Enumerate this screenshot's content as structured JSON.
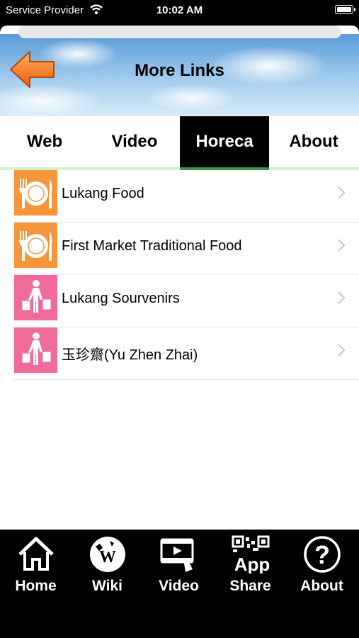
{
  "status_bar": {
    "carrier": "Service Provider",
    "time": "10:02 AM"
  },
  "header": {
    "title": "More Links"
  },
  "tabs": [
    {
      "label": "Web"
    },
    {
      "label": "Video"
    },
    {
      "label": "Horeca",
      "selected": true
    },
    {
      "label": "About"
    }
  ],
  "list": [
    {
      "label": "Lukang Food",
      "icon": "plate-utensils-icon",
      "icon_color": "#f6953a"
    },
    {
      "label": "First Market Traditional Food",
      "icon": "plate-utensils-icon",
      "icon_color": "#f6953a"
    },
    {
      "label": "Lukang Sourvenirs",
      "icon": "shopper-icon",
      "icon_color": "#f06a9a"
    },
    {
      "label": "玉珍齋(Yu Zhen Zhai)",
      "icon": "shopper-icon",
      "icon_color": "#f06a9a"
    }
  ],
  "tab_bar": [
    {
      "label": "Home",
      "icon": "house-icon"
    },
    {
      "label": "Wiki",
      "icon": "wiki-globe-icon"
    },
    {
      "label": "Video",
      "icon": "video-player-icon"
    },
    {
      "label": "Share",
      "icon": "qr-app-icon",
      "icon_text": "App"
    },
    {
      "label": "About",
      "icon": "question-icon",
      "icon_text": "?"
    }
  ],
  "colors": {
    "active_tab_bg": "#000000",
    "active_tab_indicator": "#3a9a4a",
    "tab_underline": "#ccf5c8",
    "food_icon": "#f6953a",
    "shop_icon": "#f06a9a"
  }
}
